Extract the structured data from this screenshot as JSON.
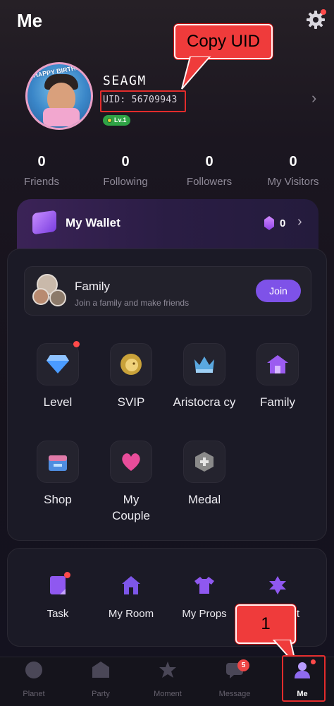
{
  "header": {
    "title": "Me"
  },
  "profile": {
    "avatar_banner": "HAPPY BIRTHDAY",
    "username": "SEAGM",
    "uid": "UID: 56709943",
    "level": "Lv.1"
  },
  "annotations": {
    "copy_uid": "Copy UID",
    "step": "1"
  },
  "stats": [
    {
      "value": "0",
      "label": "Friends"
    },
    {
      "value": "0",
      "label": "Following"
    },
    {
      "value": "0",
      "label": "Followers"
    },
    {
      "value": "0",
      "label": "My Visitors"
    }
  ],
  "wallet": {
    "label": "My Wallet",
    "balance": "0"
  },
  "family": {
    "title": "Family",
    "subtitle": "Join a family and make friends",
    "join_label": "Join"
  },
  "features": [
    {
      "label": "Level",
      "icon": "diamond-icon",
      "badge": true
    },
    {
      "label": "SVIP",
      "icon": "lion-icon",
      "badge": false
    },
    {
      "label": "Aristocra cy",
      "icon": "crown-icon",
      "badge": false
    },
    {
      "label": "Family",
      "icon": "house-icon",
      "badge": false
    },
    {
      "label": "Shop",
      "icon": "store-icon",
      "badge": false
    },
    {
      "label": "My Couple",
      "icon": "heart-icon",
      "badge": false
    },
    {
      "label": "Medal",
      "icon": "medal-icon",
      "badge": false
    }
  ],
  "tools": [
    {
      "label": "Task",
      "icon": "task-icon",
      "badge": true
    },
    {
      "label": "My Room",
      "icon": "room-icon",
      "badge": false
    },
    {
      "label": "My Props",
      "icon": "shirt-icon",
      "badge": false
    },
    {
      "label": "t",
      "icon": "settings-star-icon",
      "badge": false
    }
  ],
  "nav": [
    {
      "label": "Planet",
      "icon": "planet-icon"
    },
    {
      "label": "Party",
      "icon": "party-icon"
    },
    {
      "label": "Moment",
      "icon": "moment-icon"
    },
    {
      "label": "Message",
      "icon": "message-icon",
      "badge": "5"
    },
    {
      "label": "Me",
      "icon": "me-icon",
      "active": true
    }
  ],
  "colors": {
    "accent": "#7e52e8",
    "annotation_red": "#ef3b3b",
    "badge_red": "#ff4a4a"
  }
}
